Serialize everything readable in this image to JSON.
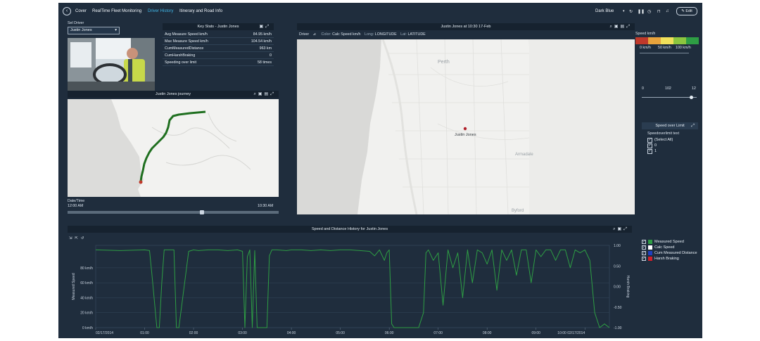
{
  "nav": {
    "tabs": [
      {
        "label": "Cover",
        "active": false
      },
      {
        "label": "RealTime Fleet Monitoring",
        "active": false
      },
      {
        "label": "Driver History",
        "active": true
      },
      {
        "label": "Itinerary and Road Info",
        "active": false
      }
    ],
    "theme_select": "Dark Blue",
    "edit_label": "Edit"
  },
  "driver_select": {
    "label": "Sel Driver",
    "value": "Justin Jones"
  },
  "key_stats": {
    "title": "Key Stats - Justin Jones",
    "rows": [
      {
        "label": "Avg Measure Speed km/h",
        "value": "84.95 km/h"
      },
      {
        "label": "Max Measure Speed km/h",
        "value": "104.54 km/h"
      },
      {
        "label": "CumMeasuredDistance",
        "value": "963 km"
      },
      {
        "label": "CumHarshBraking",
        "value": "0"
      },
      {
        "label": "Speeding over limit",
        "value": "58 times"
      }
    ]
  },
  "journey": {
    "title": "Justin Jones journey",
    "datetime_label": "Date/Time",
    "start_time": "12:00 AM",
    "end_time": "10:30 AM"
  },
  "main_map": {
    "title": "Justin Jones at 10:30 17-Feb",
    "toolbar": {
      "driver": "Driver",
      "color": "Color:",
      "color_value": "Calc Speed km/h",
      "long": "Long:",
      "long_value": "LONGITUDE",
      "lat": "Lat:",
      "lat_value": "LATITUDE"
    },
    "marker_label": "Justin Jones",
    "city_labels": [
      "Perth",
      "Armadale",
      "Byford"
    ]
  },
  "speed_legend": {
    "title": "Speed km/h",
    "ticks": [
      "0 km/h",
      "50 km/h",
      "100 km/h"
    ],
    "colors": [
      "#c0392b",
      "#e8a33c",
      "#f1e05a",
      "#8cc63f",
      "#2e9e44"
    ]
  },
  "slider": {
    "min": "0",
    "value": "102",
    "max": "12",
    "level": 0.9
  },
  "speed_over_limit": {
    "title": "Speed over Limit",
    "filter_label": "Speedoverlimit text",
    "options": [
      {
        "label": "(Select All)",
        "checked": true
      },
      {
        "label": "0",
        "checked": true
      },
      {
        "label": "1",
        "checked": true
      }
    ]
  },
  "chart_panel": {
    "title": "Speed and Distance History for Justin Jones"
  },
  "series_legend": [
    {
      "label": "Measured Speed",
      "color": "#2e9e44"
    },
    {
      "label": "Calc Speed",
      "color": "#ffffff"
    },
    {
      "label": "Cum Measured Distance",
      "color": "#1f3fbf"
    },
    {
      "label": "Harsh Braking",
      "color": "#d11f2a"
    }
  ],
  "chart_data": {
    "type": "line",
    "ylabel": "Measured Speed",
    "y2label": "Harsh Braking",
    "ylim": [
      0,
      110
    ],
    "y2lim": [
      -1,
      1
    ],
    "y_ticks": [
      {
        "value": 0,
        "label": "0 km/h"
      },
      {
        "value": 20,
        "label": "20 km/h"
      },
      {
        "value": 40,
        "label": "40 km/h"
      },
      {
        "value": 60,
        "label": "60 km/h"
      },
      {
        "value": 80,
        "label": "80 km/h"
      }
    ],
    "y2_ticks": [
      "1.00",
      "0.50",
      "0.00",
      "-0.50",
      "-1.00"
    ],
    "x_ticks": [
      "02/17/2014",
      "01:00",
      "02:00",
      "03:00",
      "04:00",
      "05:00",
      "06:00",
      "07:00",
      "08:00",
      "09:00",
      "10:00 02/17/2014"
    ],
    "xlim": [
      0,
      10.5
    ],
    "series": [
      {
        "name": "Measured Speed",
        "color": "#2e9e44",
        "x": [
          0,
          0.5,
          1.0,
          1.1,
          1.15,
          1.25,
          1.3,
          1.35,
          1.4,
          1.6,
          1.65,
          1.7,
          1.9,
          2.0,
          2.1,
          2.3,
          2.5,
          2.7,
          2.9,
          3.0,
          3.05,
          3.1,
          3.15,
          3.2,
          3.25,
          3.3,
          3.35,
          3.5,
          3.55,
          3.6,
          3.7,
          3.9,
          4.0,
          4.2,
          4.4,
          4.6,
          4.8,
          5.0,
          5.2,
          5.4,
          5.6,
          5.7,
          5.8,
          5.9,
          5.95,
          6.0,
          6.05,
          6.1,
          6.2,
          6.3,
          6.4,
          6.5,
          6.6,
          6.7,
          6.75,
          6.8,
          6.9,
          7.0,
          7.1,
          7.2,
          7.3,
          7.4,
          7.5,
          7.6,
          7.7,
          7.8,
          7.9,
          8.0,
          8.1,
          8.2,
          8.3,
          8.4,
          8.5,
          8.6,
          8.7,
          8.8,
          8.9,
          9.0,
          9.1,
          9.2,
          9.3,
          9.4,
          9.5,
          9.6,
          9.7,
          9.8,
          9.9,
          10.0,
          10.1,
          10.2,
          10.3,
          10.4,
          10.5
        ],
        "values": [
          104,
          103,
          104,
          103,
          70,
          0,
          0,
          60,
          104,
          104,
          0,
          0,
          102,
          104,
          103,
          104,
          104,
          103,
          104,
          102,
          0,
          95,
          104,
          0,
          103,
          0,
          0,
          0,
          96,
          104,
          104,
          103,
          104,
          104,
          103,
          104,
          103,
          104,
          104,
          103,
          102,
          96,
          104,
          90,
          100,
          104,
          5,
          0,
          0,
          0,
          0,
          0,
          0,
          20,
          100,
          104,
          90,
          100,
          30,
          104,
          80,
          100,
          40,
          104,
          60,
          104,
          100,
          85,
          104,
          50,
          104,
          90,
          104,
          70,
          104,
          104,
          60,
          104,
          95,
          104,
          104,
          90,
          104,
          104,
          80,
          104,
          100,
          104,
          90,
          20,
          0,
          5,
          0
        ]
      }
    ]
  }
}
